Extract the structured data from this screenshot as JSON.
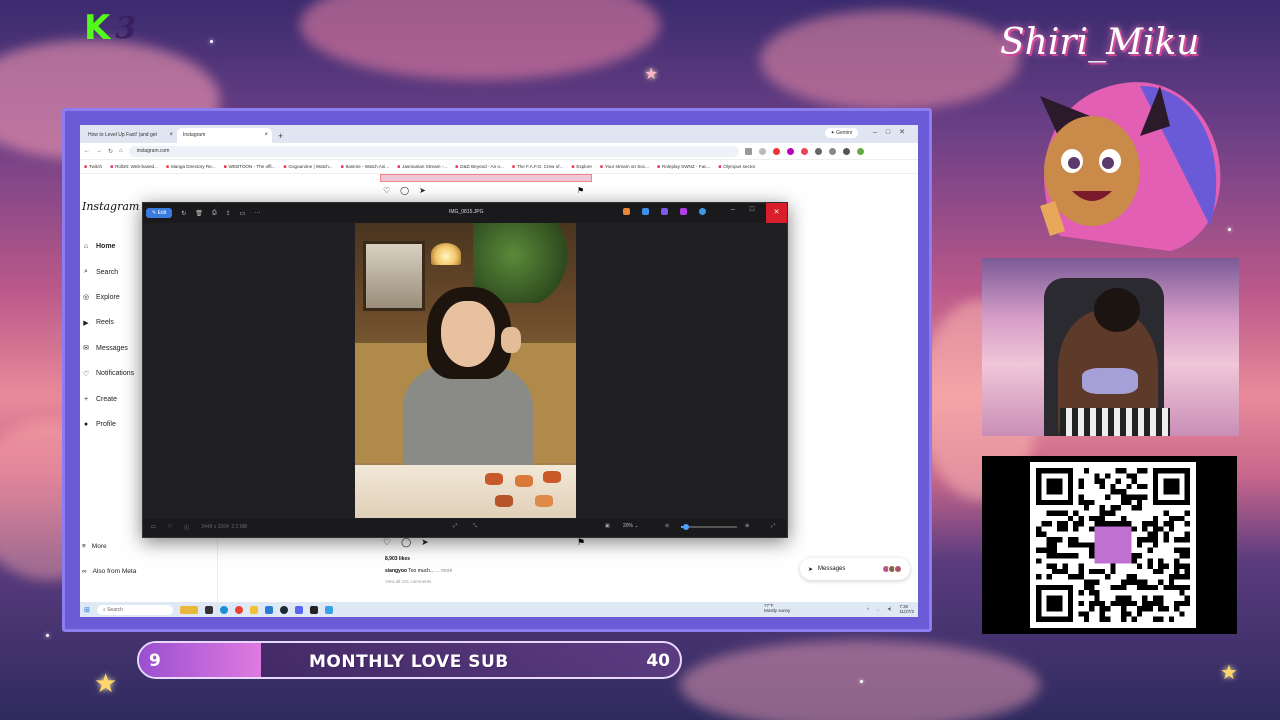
{
  "overlay": {
    "logo_k": "K",
    "logo_num": "3",
    "brand_name": "Shiri_Miku",
    "goal": {
      "current": "9",
      "label": "MONTHLY LOVE SUB",
      "target": "40",
      "progress": 0.225
    }
  },
  "browser": {
    "tabs": [
      {
        "label": "How to Level Up Fast! (and get",
        "active": false
      },
      {
        "label": "Instagram",
        "active": true
      }
    ],
    "new_tab": "+",
    "gemini_label": "✦ Gemini",
    "window_controls": "–□✕",
    "url": "instagram.com",
    "bookmarks": [
      "Twitch",
      "Roll20: Web-based...",
      "Manga Directory Re...",
      "WEBTOON - The offi...",
      "Gogoanime | Watch...",
      "9anime - Watch Ani...",
      "Jasmanian Stream -...",
      "D&D Beyond - An o...",
      "The F.A.F.O. Crew of...",
      "Explore",
      "Your stream on Soc...",
      "Roleplay SWNZ - Fac...",
      "Olympus sector"
    ]
  },
  "instagram": {
    "logo": "Instagram",
    "nav": [
      {
        "icon": "⌂",
        "label": "Home",
        "active": true
      },
      {
        "icon": "⌕",
        "label": "Search"
      },
      {
        "icon": "◎",
        "label": "Explore"
      },
      {
        "icon": "▶",
        "label": "Reels"
      },
      {
        "icon": "✉",
        "label": "Messages"
      },
      {
        "icon": "♡",
        "label": "Notifications"
      },
      {
        "icon": "+",
        "label": "Create"
      },
      {
        "icon": "●",
        "label": "Profile"
      }
    ],
    "bottom": [
      {
        "icon": "≡",
        "label": "More"
      },
      {
        "icon": "∞",
        "label": "Also from Meta"
      }
    ],
    "post": {
      "likes": "8,903 likes",
      "caption_user": "siangyoo",
      "caption_text": "Too much... ",
      "caption_more": "... more",
      "comments": "View all 101 comments"
    },
    "messages_label": "Messages"
  },
  "viewer": {
    "edit_label": "✎ Edit",
    "title": "IMG_0815.JPG",
    "dimensions": "2448 x 3264",
    "file_size": "2.2 MB",
    "zoom": "20%",
    "zoom_level": 0.2
  },
  "taskbar": {
    "search_placeholder": "Search",
    "weather_temp": "77°F",
    "weather_desc": "Mostly sunny",
    "time": "7:30",
    "date": "11/27/2"
  },
  "colors": {
    "frame": "#6b5bd6",
    "kick_green": "#53fc18",
    "viewer_close": "#d81e2a",
    "goal_fill": "#c56ad8"
  }
}
